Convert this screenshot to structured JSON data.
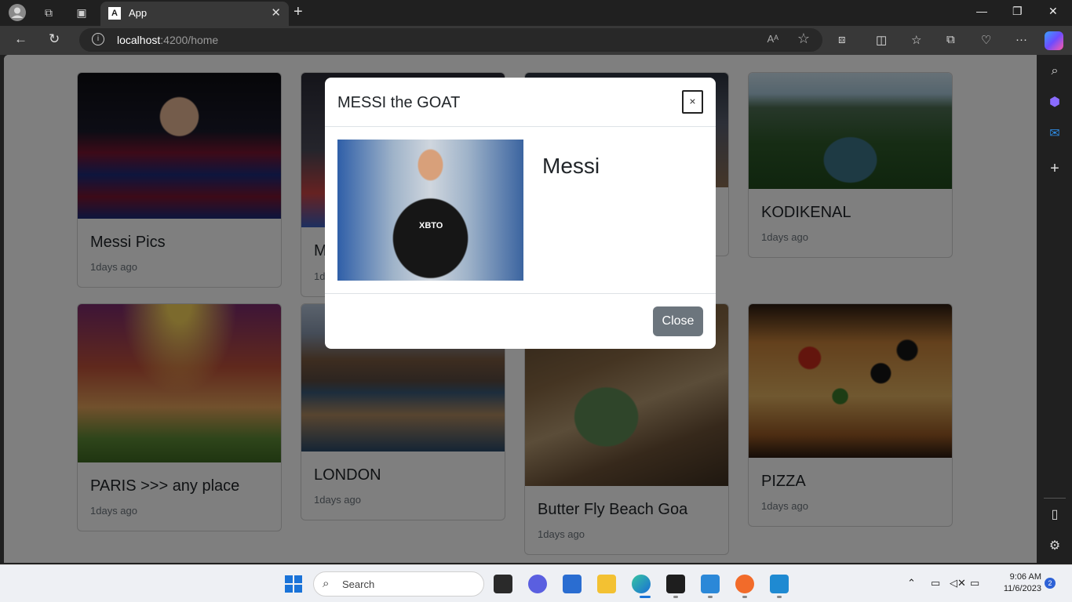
{
  "browser": {
    "tab_title": "App",
    "tab_favicon": "A",
    "url_host": "localhost",
    "url_rest": ":4200/home",
    "read_aloud": "Aᴬ"
  },
  "cards": [
    {
      "title": "Messi Pics",
      "time": "1days ago"
    },
    {
      "title": "M",
      "time": "1d"
    },
    {
      "title": "KODIKENAL",
      "time": "1days ago"
    },
    {
      "title": "PARIS >>> any place",
      "time": "1days ago"
    },
    {
      "title": "LONDON",
      "time": "1days ago"
    },
    {
      "title": "Butter Fly Beach Goa",
      "time": "1days ago"
    },
    {
      "title": "PIZZA",
      "time": "1days ago"
    }
  ],
  "modal": {
    "title": "MESSI the GOAT",
    "close_x": "×",
    "name": "Messi",
    "image_text": "XBTO",
    "close_button": "Close"
  },
  "taskbar": {
    "search_label": "Search",
    "time": "9:06 AM",
    "date": "11/6/2023",
    "notifications": "2"
  }
}
